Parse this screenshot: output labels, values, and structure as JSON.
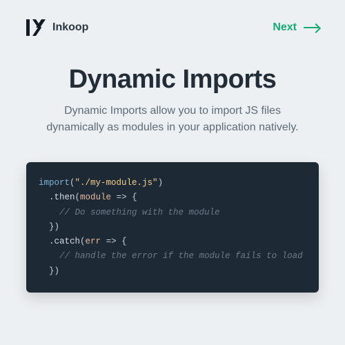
{
  "header": {
    "brand": "Inkoop",
    "next_label": "Next"
  },
  "hero": {
    "title": "Dynamic Imports",
    "subtitle": "Dynamic Imports allow you to import JS files dynamically as modules in your application natively."
  },
  "code": {
    "import_fn": "import",
    "import_arg": "\"./my-module.js\"",
    "then_method": ".then",
    "then_param": "module",
    "arrow": "=>",
    "open_brace": "{",
    "close_brace": "}",
    "close_paren": ")",
    "comment_then": "// Do something with the module",
    "catch_method": ".catch",
    "catch_param": "err",
    "comment_catch": "// handle the error if the module fails to load"
  },
  "colors": {
    "background": "#edf0f2",
    "accent": "#17a974",
    "code_bg": "#1e2936",
    "heading": "#222d37",
    "body_text": "#5e6b77"
  }
}
